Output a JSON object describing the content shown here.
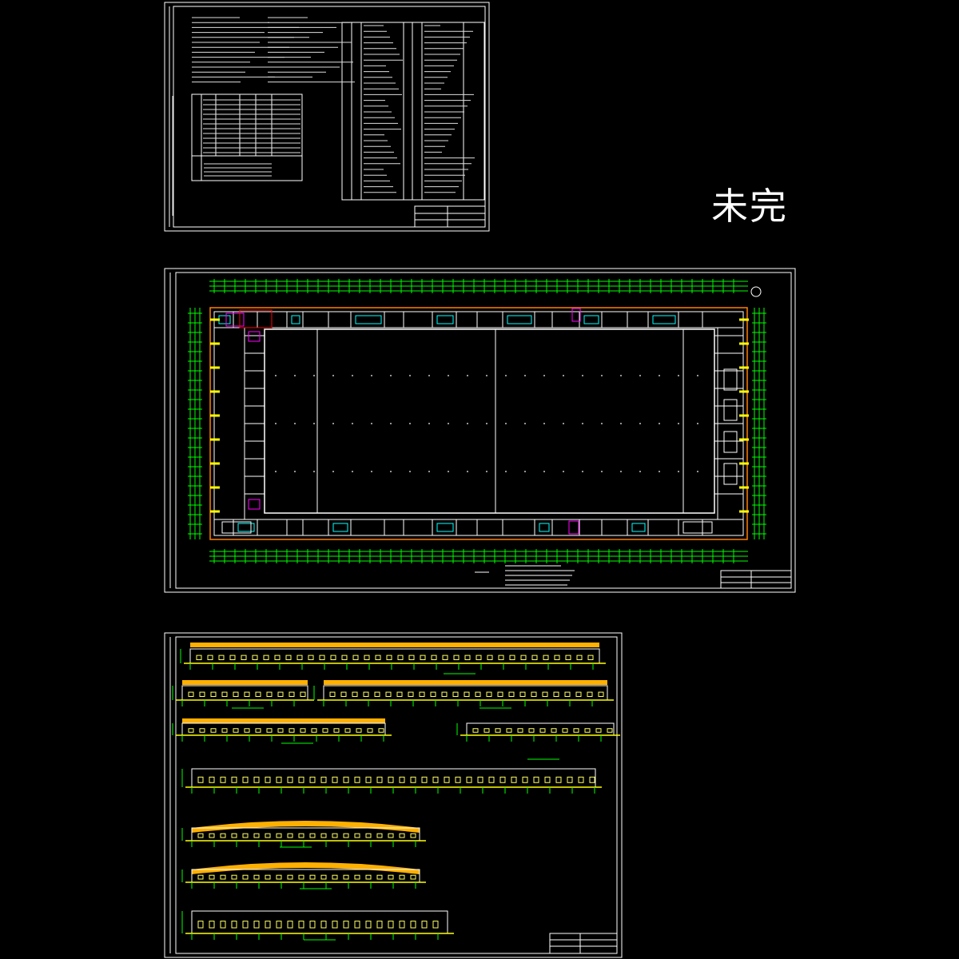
{
  "stamp": {
    "text": "未完"
  },
  "colors": {
    "background": "#000000",
    "frame": "#ffffff",
    "wall": "#ffffff",
    "dimension": "#00ff00",
    "axis": "#00ff00",
    "accent_yellow": "#ffff00",
    "accent_cyan": "#00ffff",
    "accent_magenta": "#ff00ff",
    "roof_orange": "#ffb000",
    "perimeter_orange": "#ff8000"
  },
  "sheets": [
    {
      "name": "design-notes-sheet"
    },
    {
      "name": "floor-plan-sheet"
    },
    {
      "name": "elevations-sections-sheet"
    }
  ]
}
